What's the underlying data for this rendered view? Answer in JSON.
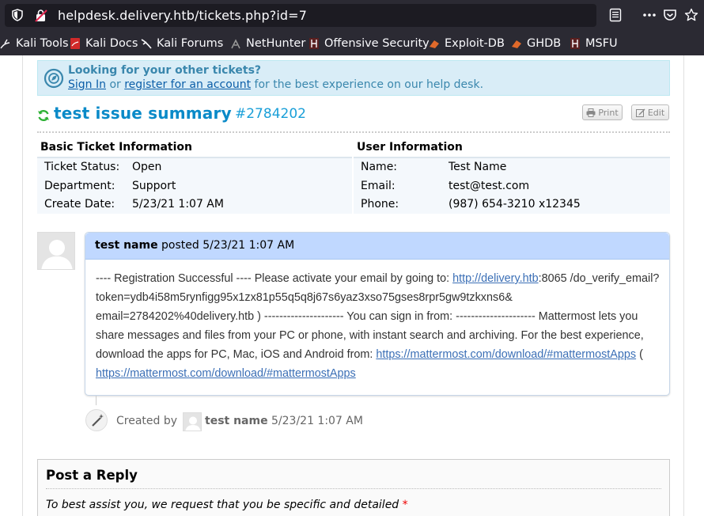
{
  "browser": {
    "url": "helpdesk.delivery.htb/tickets.php?id=7",
    "bookmarks": [
      "Kali Tools",
      "Kali Docs",
      "Kali Forums",
      "NetHunter",
      "Offensive Security",
      "Exploit-DB",
      "GHDB",
      "MSFU"
    ]
  },
  "notice": {
    "title": "Looking for your other tickets?",
    "sign_in": "Sign In",
    "or": "or",
    "register": "register for an account",
    "tail": "for the best experience on our help desk."
  },
  "ticket": {
    "title": "test issue summary",
    "number": "#2784202",
    "print_label": "Print",
    "edit_label": "Edit"
  },
  "basic_info": {
    "heading": "Basic Ticket Information",
    "rows": [
      {
        "label": "Ticket Status:",
        "value": "Open"
      },
      {
        "label": "Department:",
        "value": "Support"
      },
      {
        "label": "Create Date:",
        "value": "5/23/21 1:07 AM"
      }
    ]
  },
  "user_info": {
    "heading": "User Information",
    "rows": [
      {
        "label": "Name:",
        "value": "Test Name"
      },
      {
        "label": "Email:",
        "value": "test@test.com"
      },
      {
        "label": "Phone:",
        "value": "(987) 654-3210 x12345"
      }
    ]
  },
  "thread": {
    "author": "test name",
    "posted": "posted 5/23/21 1:07 AM",
    "body_1": "---- Registration Successful ---- Please activate your email by going to: ",
    "link_1": "http://delivery.htb",
    "body_2": ":8065 /do_verify_email?token=ydb4i58m5rynfigg95x1zx81p55q5q8j67s6yaz3xso75gses8rpr5gw9tzkxns6& email=2784202%40delivery.htb ) --------------------- You can sign in from: --------------------- Mattermost lets you share messages and files from your PC or phone, with instant search and archiving. For the best experience, download the apps for PC, Mac, iOS and Android from: ",
    "link_2": "https://mattermost.com/download/#mattermostApps",
    "body_3": " ( ",
    "link_3": "https://mattermost.com/download/#mattermostApps"
  },
  "event": {
    "created_by": "Created by",
    "name": "test name",
    "time": "5/23/21 1:07 AM"
  },
  "reply": {
    "title": "Post a Reply",
    "instruction": "To best assist you, we request that you be specific and detailed",
    "required_mark": "*"
  }
}
